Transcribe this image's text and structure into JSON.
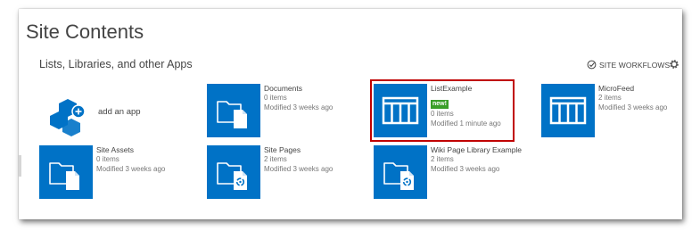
{
  "page": {
    "title": "Site Contents"
  },
  "section": {
    "title": "Lists, Libraries, and other Apps",
    "workflows_label": "SITE WORKFLOWS"
  },
  "add_app": {
    "label": "add an app"
  },
  "tiles": [
    {
      "name": "Documents",
      "items": "0 items",
      "modified": "Modified 3 weeks ago",
      "icon": "document-library-icon"
    },
    {
      "name": "ListExample",
      "badge": "new!",
      "items": "0 items",
      "modified": "Modified 1 minute ago",
      "icon": "list-icon"
    },
    {
      "name": "MicroFeed",
      "items": "2 items",
      "modified": "Modified 3 weeks ago",
      "icon": "list-icon"
    },
    {
      "name": "Site Assets",
      "items": "0 items",
      "modified": "Modified 3 weeks ago",
      "icon": "document-library-icon"
    },
    {
      "name": "Site Pages",
      "items": "2 items",
      "modified": "Modified 3 weeks ago",
      "icon": "wiki-library-icon"
    },
    {
      "name": "Wiki Page Library Example",
      "items": "2 items",
      "modified": "Modified 3 weeks ago",
      "icon": "wiki-library-icon"
    }
  ],
  "colors": {
    "tile_blue": "#0072c6",
    "badge_green": "#3a9e28",
    "highlight_red": "#c00000"
  }
}
